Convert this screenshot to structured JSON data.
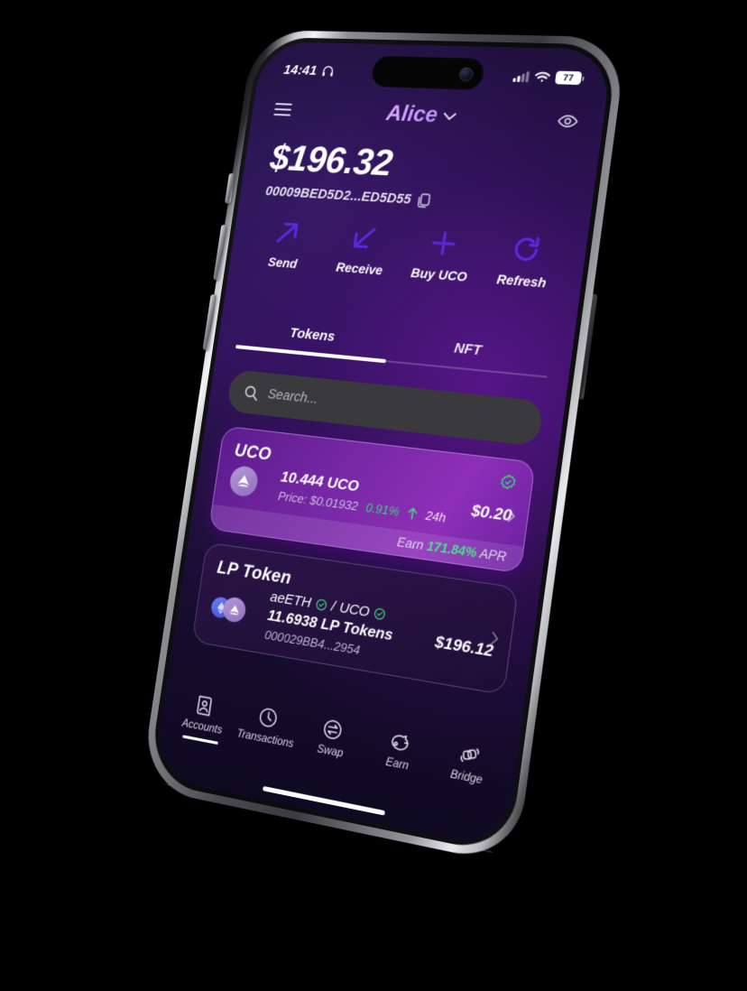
{
  "status_bar": {
    "time": "14:41",
    "headphone_icon": "headphone-icon",
    "signal_icon": "cellular-signal-icon",
    "wifi_icon": "wifi-icon",
    "battery_level": "77"
  },
  "header": {
    "menu_icon": "hamburger-menu-icon",
    "account_name": "Alice",
    "chevron_icon": "chevron-down-icon",
    "visibility_icon": "eye-icon"
  },
  "balance": {
    "total": "$196.32",
    "address": "00009BED5D2...ED5D55",
    "copy_icon": "copy-icon"
  },
  "actions": [
    {
      "label": "Send",
      "icon": "arrow-up-right-icon"
    },
    {
      "label": "Receive",
      "icon": "arrow-down-left-icon"
    },
    {
      "label": "Buy UCO",
      "icon": "plus-icon"
    },
    {
      "label": "Refresh",
      "icon": "refresh-icon"
    }
  ],
  "tabs": [
    {
      "label": "Tokens",
      "active": true
    },
    {
      "label": "NFT",
      "active": false
    }
  ],
  "search": {
    "placeholder": "Search...",
    "value": "",
    "icon": "search-icon"
  },
  "tokens": [
    {
      "name": "UCO",
      "amount": "10.444 UCO",
      "price_label": "Price: $0.01932",
      "change": "0.91%",
      "change_arrow": "arrow-up-icon",
      "period": "24h",
      "fiat_value": "$0.20",
      "verified_icon": "verified-badge-icon",
      "earn_prefix": "Earn",
      "earn_apr": "171.84%",
      "earn_suffix": "APR",
      "chevron": "chevron-right-icon"
    },
    {
      "name": "LP Token",
      "pair_left": "aeETH",
      "pair_sep": "/",
      "pair_right": "UCO",
      "amount": "11.6938 LP Tokens",
      "address": "000029BB4...2954",
      "fiat_value": "$196.12",
      "chevron": "chevron-right-icon"
    }
  ],
  "bottom_nav": [
    {
      "label": "Accounts",
      "icon": "contact-card-icon",
      "active": true
    },
    {
      "label": "Transactions",
      "icon": "clock-icon",
      "active": false
    },
    {
      "label": "Swap",
      "icon": "swap-arrows-icon",
      "active": false
    },
    {
      "label": "Earn",
      "icon": "wallet-icon",
      "active": false
    },
    {
      "label": "Bridge",
      "icon": "bridge-rotate-icon",
      "active": false
    }
  ],
  "colors": {
    "accent_purple": "#5B28E0",
    "brand_violet": "#8E2FB8",
    "positive_green": "#3FD17F",
    "name_gradient": "#D9A8FF",
    "screen_bg": "#2D1257"
  }
}
